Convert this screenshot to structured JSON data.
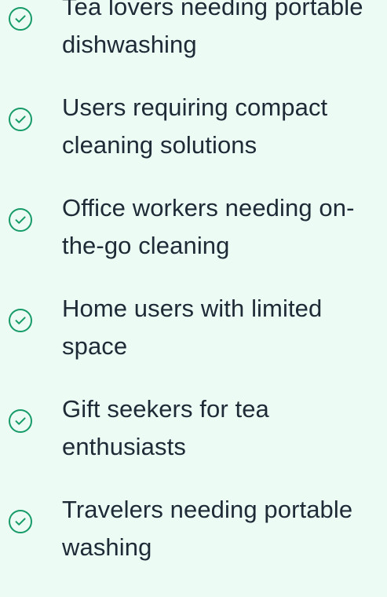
{
  "items": [
    {
      "label": "Tea lovers needing portable dishwashing",
      "icon": "check-circle-icon"
    },
    {
      "label": "Users requiring compact cleaning solutions",
      "icon": "check-circle-icon"
    },
    {
      "label": "Office workers needing on-the-go cleaning",
      "icon": "check-circle-icon"
    },
    {
      "label": "Home users with limited space",
      "icon": "check-circle-icon"
    },
    {
      "label": "Gift seekers for tea enthusiasts",
      "icon": "check-circle-icon"
    },
    {
      "label": "Travelers needing portable washing",
      "icon": "check-circle-icon"
    }
  ],
  "colors": {
    "background": "#ecfbf4",
    "text": "#1f2a37",
    "accent": "#169b68"
  }
}
